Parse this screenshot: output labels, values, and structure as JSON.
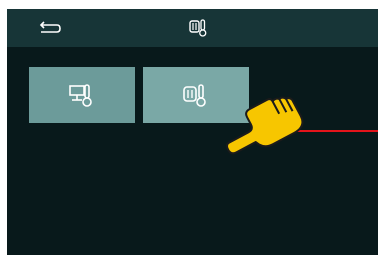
{
  "app": {
    "title_icon": "radiator-thermometer-icon"
  },
  "header": {
    "back_icon": "back-arrow-icon"
  },
  "tiles": [
    {
      "icon": "heating-monitor-thermometer-icon",
      "selected": false
    },
    {
      "icon": "radiator-thermometer-icon",
      "selected": true
    }
  ],
  "colors": {
    "screen_bg": "#08191b",
    "header_bg": "#173537",
    "tile_bg": "#6c9b9a",
    "tile_selected_bg": "#7aa8a6",
    "icon_color": "#ffffff",
    "pointer_hand": "#f7c600",
    "guide_line": "#e4141b"
  }
}
